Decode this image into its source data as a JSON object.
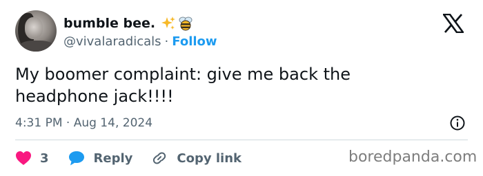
{
  "author": {
    "display_name": "bumble bee.",
    "handle": "@vivalaradicals",
    "separator": "·",
    "follow_label": "Follow",
    "name_emoji": [
      "sparkles-icon",
      "bee-icon"
    ]
  },
  "tweet": {
    "text": "My boomer complaint: give me back the\nheadphone jack!!!!",
    "timestamp": "4:31 PM · Aug 14, 2024"
  },
  "actions": {
    "like_count": "3",
    "reply_label": "Reply",
    "copy_link_label": "Copy link"
  },
  "watermark": "boredpanda.com",
  "colors": {
    "accent": "#1d9bf0",
    "like": "#f91880",
    "text": "#0f1419",
    "secondary": "#536471",
    "divider": "#cfd9de"
  }
}
